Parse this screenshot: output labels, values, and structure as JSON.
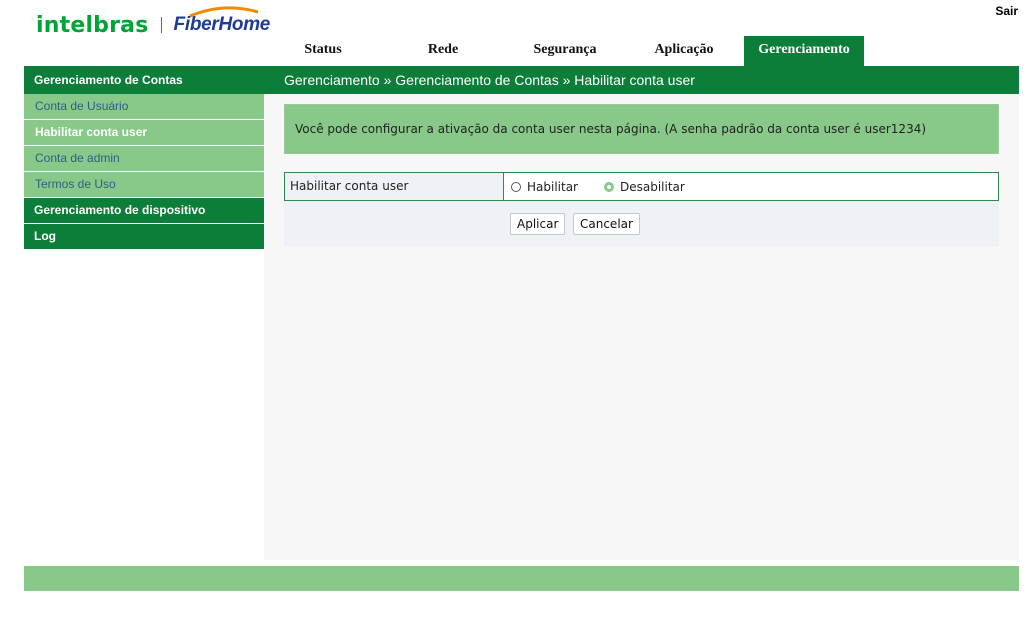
{
  "logo": {
    "brand1": "intelbras",
    "brand2": "FiberHome"
  },
  "header": {
    "logout": "Sair"
  },
  "tabs": [
    {
      "label": "Status"
    },
    {
      "label": "Rede"
    },
    {
      "label": "Segurança"
    },
    {
      "label": "Aplicação"
    },
    {
      "label": "Gerenciamento",
      "active": true
    }
  ],
  "breadcrumb": "Gerenciamento » Gerenciamento de Contas » Habilitar conta user",
  "sidebar": {
    "section1": "Gerenciamento de Contas",
    "items": [
      {
        "label": "Conta de Usuário"
      },
      {
        "label": "Habilitar conta user",
        "active": true
      },
      {
        "label": "Conta de admin"
      },
      {
        "label": "Termos de Uso"
      }
    ],
    "section2": "Gerenciamento de dispositivo",
    "section3": "Log"
  },
  "content": {
    "info": "Você pode configurar a ativação da conta user nesta página. (A senha padrão da conta user é user1234)",
    "field_label": "Habilitar conta user",
    "options": [
      {
        "label": "Habilitar",
        "checked": false
      },
      {
        "label": "Desabilitar",
        "checked": true
      }
    ],
    "apply": "Aplicar",
    "cancel": "Cancelar"
  },
  "colors": {
    "primary_green": "#0d7d3a",
    "light_green": "#88c888",
    "link_blue": "#2f5e8a"
  }
}
